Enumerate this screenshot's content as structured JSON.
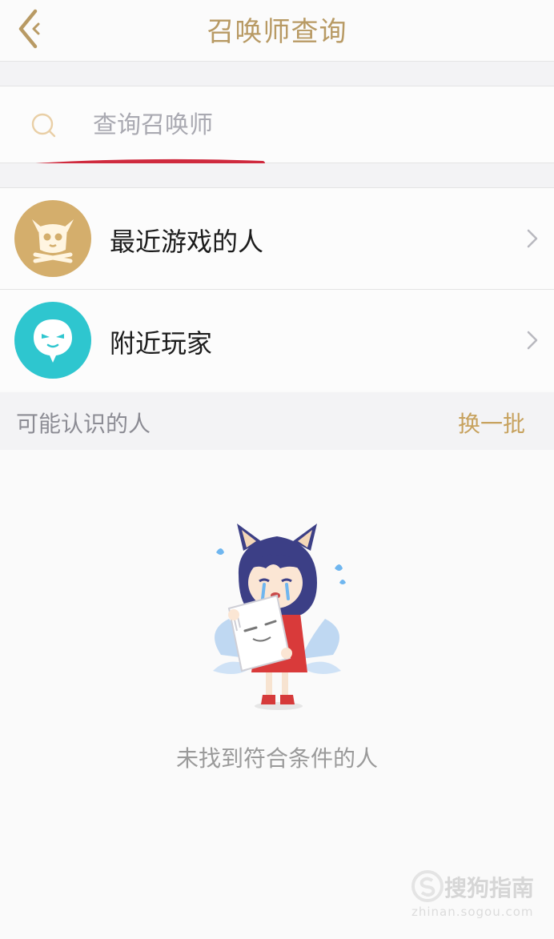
{
  "header": {
    "title": "召唤师查询",
    "back_icon": "back-arrow-icon",
    "accent_color": "#b89a64"
  },
  "search": {
    "placeholder": "查询召唤师",
    "value": "",
    "icon": "search-icon"
  },
  "list": {
    "items": [
      {
        "label": "最近游戏的人",
        "icon": "helmet-skull-icon",
        "icon_color": "#d4ae6c"
      },
      {
        "label": "附近玩家",
        "icon": "chat-ghost-icon",
        "icon_color": "#2ec6cf"
      }
    ]
  },
  "section": {
    "title": "可能认识的人",
    "action_label": "换一批",
    "action_color": "#c7a25e"
  },
  "empty_state": {
    "message": "未找到符合条件的人",
    "illustration": "crying-fox-girl-illustration"
  },
  "watermark": {
    "brand": "搜狗指南",
    "url": "zhinan.sogou.com"
  }
}
